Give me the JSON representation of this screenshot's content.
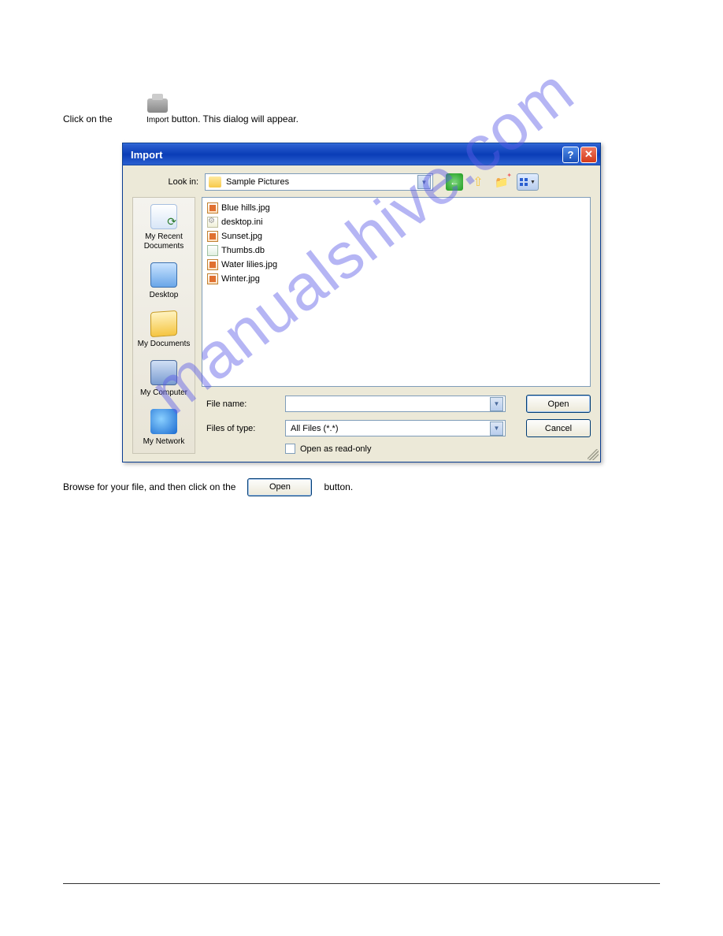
{
  "page": {
    "intro_prefix": "Click on the",
    "intro_suffix": "button. This dialog will appear.",
    "import_label": "Import",
    "after_prefix": "Browse for your file, and then click on the",
    "after_suffix": "button.",
    "open_inline": "Open"
  },
  "dialog": {
    "title": "Import",
    "help": "?",
    "close": "✕",
    "lookin_label": "Look in:",
    "lookin_value": "Sample Pictures",
    "files": [
      {
        "name": "Blue hills.jpg",
        "type": "img"
      },
      {
        "name": "desktop.ini",
        "type": "ini"
      },
      {
        "name": "Sunset.jpg",
        "type": "img"
      },
      {
        "name": "Thumbs.db",
        "type": "db"
      },
      {
        "name": "Water lilies.jpg",
        "type": "img"
      },
      {
        "name": "Winter.jpg",
        "type": "img"
      }
    ],
    "places": [
      {
        "label": "My Recent Documents",
        "key": "recent"
      },
      {
        "label": "Desktop",
        "key": "desktop"
      },
      {
        "label": "My Documents",
        "key": "docs"
      },
      {
        "label": "My Computer",
        "key": "computer"
      },
      {
        "label": "My Network",
        "key": "network"
      }
    ],
    "filename_label": "File name:",
    "filename_value": "",
    "filetype_label": "Files of type:",
    "filetype_value": "All Files (*.*)",
    "open_btn": "Open",
    "cancel_btn": "Cancel",
    "readonly_label": "Open as read-only"
  },
  "watermark": "manualshive.com",
  "footer": {
    "left": "",
    "right": ""
  }
}
